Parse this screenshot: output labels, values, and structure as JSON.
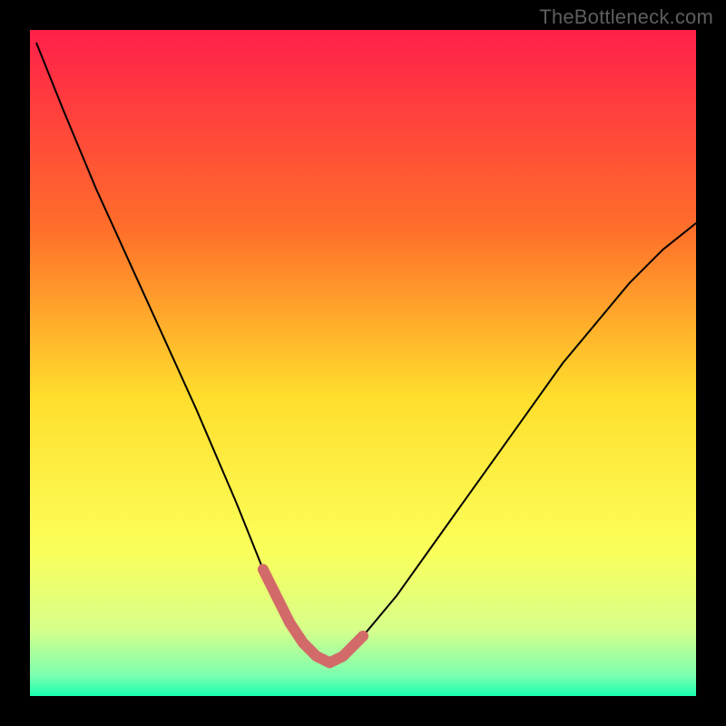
{
  "watermark": {
    "text": "TheBottleneck.com"
  },
  "chart_data": {
    "type": "line",
    "title": "",
    "xlabel": "",
    "ylabel": "",
    "xlim": [
      0,
      100
    ],
    "ylim": [
      0,
      100
    ],
    "grid": false,
    "legend": false,
    "annotations": [],
    "background_gradient": {
      "stops": [
        {
          "offset": 0.0,
          "color": "#ff1f4a"
        },
        {
          "offset": 0.3,
          "color": "#ff6f2a"
        },
        {
          "offset": 0.55,
          "color": "#ffde2c"
        },
        {
          "offset": 0.78,
          "color": "#fbff5a"
        },
        {
          "offset": 0.9,
          "color": "#d7ff8a"
        },
        {
          "offset": 0.97,
          "color": "#7affb0"
        },
        {
          "offset": 1.0,
          "color": "#18ffaf"
        }
      ]
    },
    "series": [
      {
        "name": "bottleneck-curve",
        "color": "#000000",
        "width": 2,
        "x": [
          1,
          5,
          10,
          15,
          20,
          25,
          28,
          31,
          33,
          35,
          37,
          39,
          41,
          43,
          45,
          47,
          50,
          55,
          60,
          65,
          70,
          75,
          80,
          85,
          90,
          95,
          100
        ],
        "y": [
          98,
          88,
          76,
          65,
          54,
          43,
          36,
          29,
          24,
          19,
          15,
          11,
          8,
          6,
          5,
          6,
          9,
          15,
          22,
          29,
          36,
          43,
          50,
          56,
          62,
          67,
          71
        ]
      },
      {
        "name": "optimal-zone-highlight",
        "color": "#d36a6a",
        "width": 12,
        "x": [
          35,
          37,
          39,
          41,
          43,
          45,
          47,
          50
        ],
        "y": [
          19,
          15,
          11,
          8,
          6,
          5,
          6,
          9
        ]
      }
    ]
  }
}
